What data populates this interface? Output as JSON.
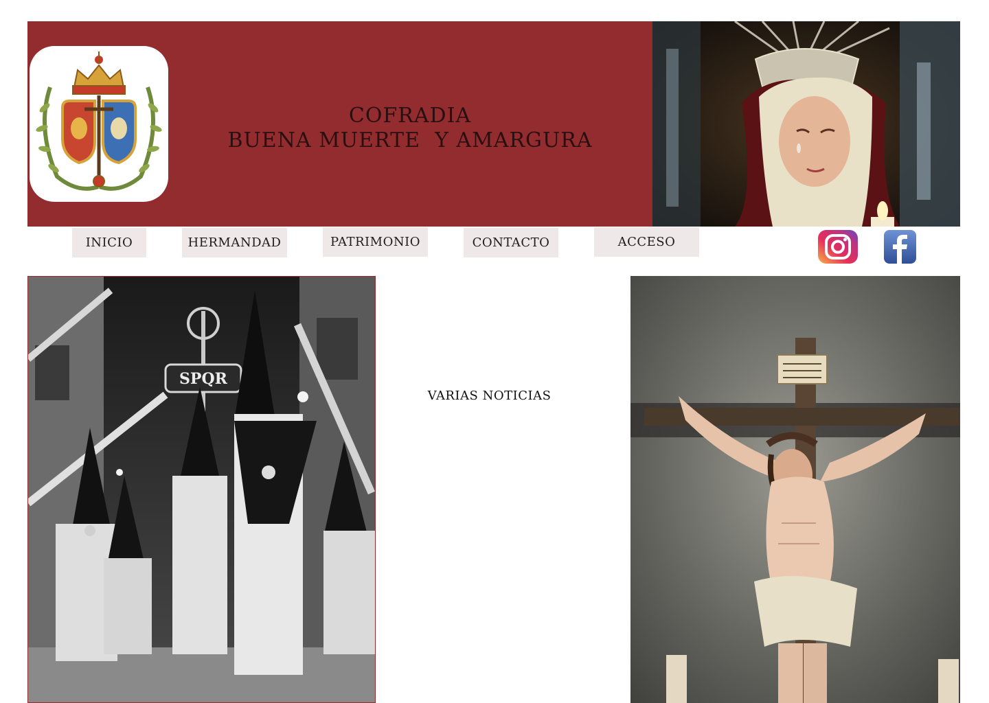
{
  "header": {
    "title_line1": "COFRADIA",
    "title_line2": "BUENA MUERTE  Y AMARGURA",
    "logo": "brotherhood-coat-of-arms",
    "hero_image": "virgin-amargura-photo",
    "banner_color": "#922c2f"
  },
  "nav": {
    "items": [
      {
        "label": "INICIO"
      },
      {
        "label": "HERMANDAD"
      },
      {
        "label": "PATRIMONIO"
      },
      {
        "label": "CONTACTO"
      },
      {
        "label": "ACCESO"
      }
    ]
  },
  "social": [
    {
      "icon": "instagram-icon"
    },
    {
      "icon": "facebook-icon"
    }
  ],
  "main": {
    "news_heading": "VARIAS NOTICIAS",
    "left_image": "procession-nazarenos-photo",
    "right_image": "crucified-christ-photo"
  }
}
